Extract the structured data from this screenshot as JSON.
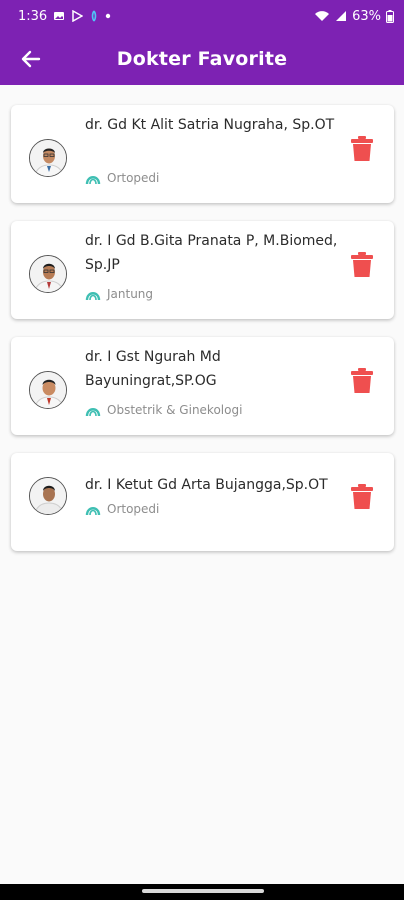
{
  "status_bar": {
    "time": "1:36",
    "battery": "63%",
    "bg_color": "#7d22b3"
  },
  "app_bar": {
    "title": "Dokter Favorite",
    "back_icon": "arrow-left-icon"
  },
  "colors": {
    "primary": "#7d22b3",
    "delete": "#ef4f4f",
    "spec_icon": "#3fbfb3"
  },
  "doctors": [
    {
      "name": "dr. Gd Kt Alit Satria Nugraha, Sp.OT",
      "specialty": "Ortopedi"
    },
    {
      "name": "dr. I Gd B.Gita Pranata P, M.Biomed, Sp.JP",
      "specialty": "Jantung"
    },
    {
      "name": "dr. I Gst Ngurah Md Bayuningrat,SP.OG",
      "specialty": "Obstetrik & Ginekologi"
    },
    {
      "name": "dr. I Ketut Gd Arta Bujangga,Sp.OT",
      "specialty": "Ortopedi"
    }
  ]
}
